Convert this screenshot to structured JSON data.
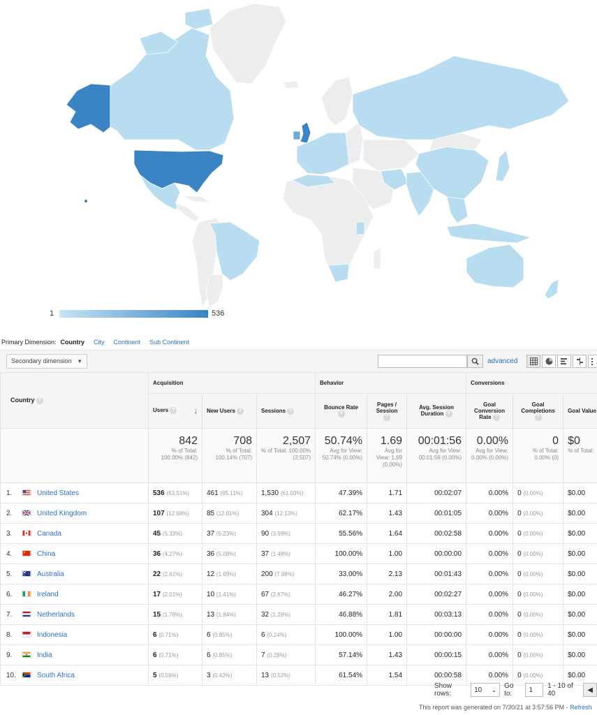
{
  "legend": {
    "min": "1",
    "max": "536"
  },
  "primary_dimension": {
    "label": "Primary Dimension:",
    "current": "Country",
    "options": [
      "City",
      "Continent",
      "Sub Continent"
    ]
  },
  "toolbar": {
    "secondary_dimension": "Secondary dimension",
    "search_placeholder": "",
    "advanced": "advanced"
  },
  "table": {
    "dimension_header": "Country",
    "groups": {
      "acquisition": "Acquisition",
      "behavior": "Behavior",
      "conversions": "Conversions"
    },
    "columns": [
      "Users",
      "New Users",
      "Sessions",
      "Bounce Rate",
      "Pages / Session",
      "Avg. Session Duration",
      "Goal Conversion Rate",
      "Goal Completions",
      "Goal Value"
    ],
    "totals": {
      "users": {
        "value": "842",
        "sub": "% of Total: 100.00% (842)"
      },
      "new_users": {
        "value": "708",
        "sub": "% of Total: 100.14% (707)"
      },
      "sessions": {
        "value": "2,507",
        "sub": "% of Total: 100.00% (2,507)"
      },
      "bounce_rate": {
        "value": "50.74%",
        "sub": "Avg for View: 50.74% (0.00%)"
      },
      "pages_session": {
        "value": "1.69",
        "sub": "Avg for View: 1.69 (0.00%)"
      },
      "avg_duration": {
        "value": "00:01:56",
        "sub": "Avg for View: 00:01:56 (0.00%)"
      },
      "goal_conv_rate": {
        "value": "0.00%",
        "sub": "Avg for View: 0.00% (0.00%)"
      },
      "goal_completions": {
        "value": "0",
        "sub": "% of Total: 0.00% (0)"
      },
      "goal_value": {
        "value": "$0",
        "sub": "% of Total:"
      }
    },
    "rows": [
      {
        "rank": "1.",
        "country": "United States",
        "flag": "us",
        "users": "536",
        "users_pct": "(63.51%)",
        "new_users": "461",
        "new_users_pct": "(65.11%)",
        "sessions": "1,530",
        "sessions_pct": "(61.03%)",
        "bounce": "47.39%",
        "pages": "1.71",
        "duration": "00:02:07",
        "conv": "0.00%",
        "completions": "0",
        "completions_pct": "(0.00%)",
        "value": "$0.00"
      },
      {
        "rank": "2.",
        "country": "United Kingdom",
        "flag": "gb",
        "users": "107",
        "users_pct": "(12.68%)",
        "new_users": "85",
        "new_users_pct": "(12.01%)",
        "sessions": "304",
        "sessions_pct": "(12.13%)",
        "bounce": "62.17%",
        "pages": "1.43",
        "duration": "00:01:05",
        "conv": "0.00%",
        "completions": "0",
        "completions_pct": "(0.00%)",
        "value": "$0.00"
      },
      {
        "rank": "3.",
        "country": "Canada",
        "flag": "ca",
        "users": "45",
        "users_pct": "(5.33%)",
        "new_users": "37",
        "new_users_pct": "(5.23%)",
        "sessions": "90",
        "sessions_pct": "(3.59%)",
        "bounce": "55.56%",
        "pages": "1.64",
        "duration": "00:02:58",
        "conv": "0.00%",
        "completions": "0",
        "completions_pct": "(0.00%)",
        "value": "$0.00"
      },
      {
        "rank": "4.",
        "country": "China",
        "flag": "cn",
        "users": "36",
        "users_pct": "(4.27%)",
        "new_users": "36",
        "new_users_pct": "(5.08%)",
        "sessions": "37",
        "sessions_pct": "(1.48%)",
        "bounce": "100.00%",
        "pages": "1.00",
        "duration": "00:00:00",
        "conv": "0.00%",
        "completions": "0",
        "completions_pct": "(0.00%)",
        "value": "$0.00"
      },
      {
        "rank": "5.",
        "country": "Australia",
        "flag": "au",
        "users": "22",
        "users_pct": "(2.61%)",
        "new_users": "12",
        "new_users_pct": "(1.69%)",
        "sessions": "200",
        "sessions_pct": "(7.98%)",
        "bounce": "33.00%",
        "pages": "2.13",
        "duration": "00:01:43",
        "conv": "0.00%",
        "completions": "0",
        "completions_pct": "(0.00%)",
        "value": "$0.00"
      },
      {
        "rank": "6.",
        "country": "Ireland",
        "flag": "ie",
        "users": "17",
        "users_pct": "(2.01%)",
        "new_users": "10",
        "new_users_pct": "(1.41%)",
        "sessions": "67",
        "sessions_pct": "(2.67%)",
        "bounce": "46.27%",
        "pages": "2.00",
        "duration": "00:02:27",
        "conv": "0.00%",
        "completions": "0",
        "completions_pct": "(0.00%)",
        "value": "$0.00"
      },
      {
        "rank": "7.",
        "country": "Netherlands",
        "flag": "nl",
        "users": "15",
        "users_pct": "(1.78%)",
        "new_users": "13",
        "new_users_pct": "(1.84%)",
        "sessions": "32",
        "sessions_pct": "(1.28%)",
        "bounce": "46.88%",
        "pages": "1.81",
        "duration": "00:03:13",
        "conv": "0.00%",
        "completions": "0",
        "completions_pct": "(0.00%)",
        "value": "$0.00"
      },
      {
        "rank": "8.",
        "country": "Indonesia",
        "flag": "id",
        "users": "6",
        "users_pct": "(0.71%)",
        "new_users": "6",
        "new_users_pct": "(0.85%)",
        "sessions": "6",
        "sessions_pct": "(0.24%)",
        "bounce": "100.00%",
        "pages": "1.00",
        "duration": "00:00:00",
        "conv": "0.00%",
        "completions": "0",
        "completions_pct": "(0.00%)",
        "value": "$0.00"
      },
      {
        "rank": "9.",
        "country": "India",
        "flag": "in",
        "users": "6",
        "users_pct": "(0.71%)",
        "new_users": "6",
        "new_users_pct": "(0.85%)",
        "sessions": "7",
        "sessions_pct": "(0.28%)",
        "bounce": "57.14%",
        "pages": "1.43",
        "duration": "00:00:15",
        "conv": "0.00%",
        "completions": "0",
        "completions_pct": "(0.00%)",
        "value": "$0.00"
      },
      {
        "rank": "10.",
        "country": "South Africa",
        "flag": "za",
        "users": "5",
        "users_pct": "(0.59%)",
        "new_users": "3",
        "new_users_pct": "(0.42%)",
        "sessions": "13",
        "sessions_pct": "(0.52%)",
        "bounce": "61.54%",
        "pages": "1.54",
        "duration": "00:00:58",
        "conv": "0.00%",
        "completions": "0",
        "completions_pct": "(0.00%)",
        "value": "$0.00"
      }
    ]
  },
  "pager": {
    "show_rows_label": "Show rows:",
    "show_rows_value": "10",
    "goto_label": "Go to:",
    "goto_value": "1",
    "range": "1 - 10 of 40"
  },
  "footer": {
    "generated": "This report was generated on 7/30/21 at 3:57:56 PM - ",
    "refresh": "Refresh"
  },
  "colors": {
    "max": "#3a84c3",
    "light": "#b8ddf1",
    "none": "#ededed",
    "link": "#2a6fbf"
  }
}
